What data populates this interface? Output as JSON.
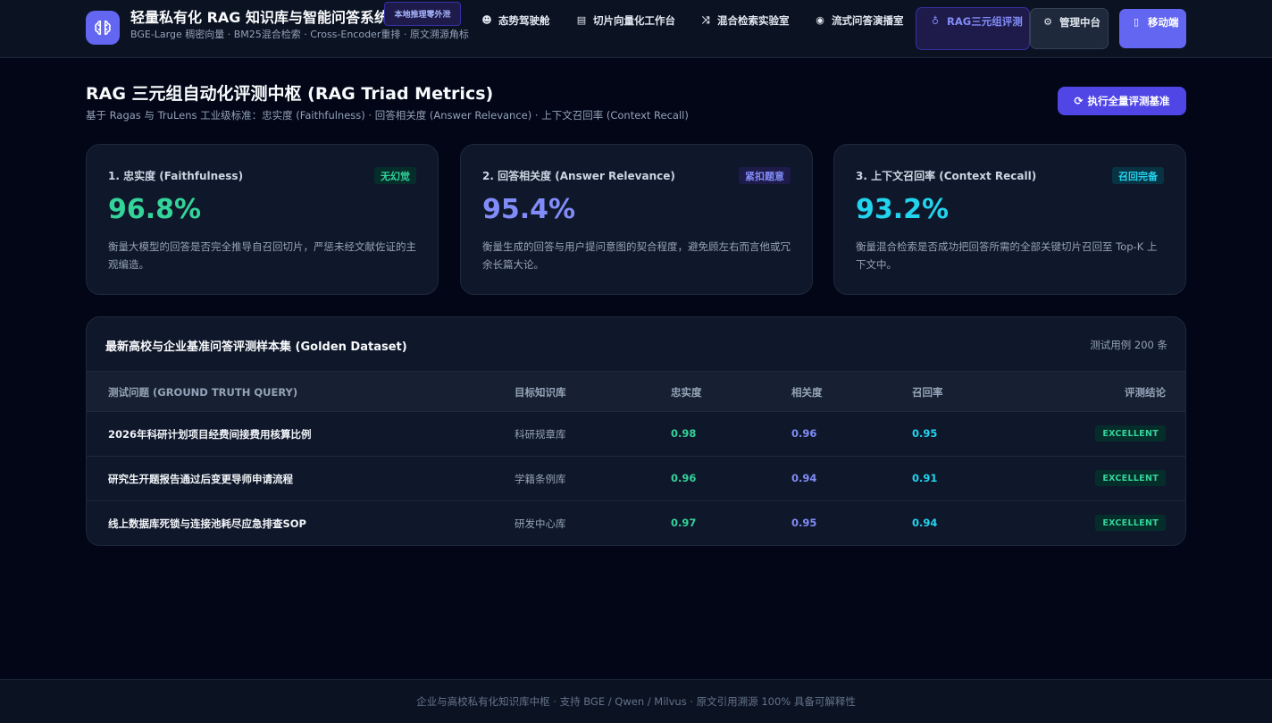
{
  "colors": {
    "accent": "#6366f1",
    "faithfulness": "#34d399",
    "relevance": "#818cf8",
    "recall": "#22d3ee",
    "excellent": "#34d399"
  },
  "header": {
    "logo_icon": "brain-icon",
    "title": "轻量私有化 RAG 知识库与智能问答系统",
    "badge": "本地推理零外泄",
    "subtitle": "BGE-Large 稠密向量 · BM25混合检索 · Cross-Encoder重排 · 原文溯源角标"
  },
  "nav": [
    {
      "icon": "dashboard-icon",
      "glyph": "☻",
      "label": "态势驾驶舱"
    },
    {
      "icon": "document-icon",
      "glyph": "▤",
      "label": "切片向量化工作台"
    },
    {
      "icon": "shuffle-icon",
      "glyph": "⤨",
      "label": "混合检索实验室"
    },
    {
      "icon": "chat-icon",
      "glyph": "◉",
      "label": "流式问答演播室"
    },
    {
      "icon": "medal-icon",
      "glyph": "♁",
      "label": "RAG三元组评测"
    },
    {
      "icon": "gear-icon",
      "glyph": "⚙",
      "label": "管理中台"
    },
    {
      "icon": "mobile-icon",
      "glyph": "▯",
      "label": "移动端"
    }
  ],
  "page": {
    "title": "RAG 三元组自动化评测中枢 (RAG Triad Metrics)",
    "subtitle": "基于 Ragas 与 TruLens 工业级标准：忠实度 (Faithfulness) · 回答相关度 (Answer Relevance) · 上下文召回率 (Context Recall)",
    "run_button": "执行全量评测基准"
  },
  "metrics": [
    {
      "title": "1. 忠实度 (Faithfulness)",
      "tag": "无幻觉",
      "value": "96.8%",
      "desc": "衡量大模型的回答是否完全推导自召回切片，严惩未经文献佐证的主观编造。"
    },
    {
      "title": "2. 回答相关度 (Answer Relevance)",
      "tag": "紧扣题意",
      "value": "95.4%",
      "desc": "衡量生成的回答与用户提问意图的契合程度，避免顾左右而言他或冗余长篇大论。"
    },
    {
      "title": "3. 上下文召回率 (Context Recall)",
      "tag": "召回完备",
      "value": "93.2%",
      "desc": "衡量混合检索是否成功把回答所需的全部关键切片召回至 Top-K 上下文中。"
    }
  ],
  "dataset": {
    "title": "最新高校与企业基准问答评测样本集 (Golden Dataset)",
    "count": "测试用例 200 条",
    "columns": [
      "测试问题 (GROUND TRUTH QUERY)",
      "目标知识库",
      "忠实度",
      "相关度",
      "召回率",
      "评测结论"
    ],
    "rows": [
      {
        "query": "2026年科研计划项目经费间接费用核算比例",
        "kb": "科研规章库",
        "faithfulness": "0.98",
        "relevance": "0.96",
        "recall": "0.95",
        "verdict": "EXCELLENT"
      },
      {
        "query": "研究生开题报告通过后变更导师申请流程",
        "kb": "学籍条例库",
        "faithfulness": "0.96",
        "relevance": "0.94",
        "recall": "0.91",
        "verdict": "EXCELLENT"
      },
      {
        "query": "线上数据库死锁与连接池耗尽应急排查SOP",
        "kb": "研发中心库",
        "faithfulness": "0.97",
        "relevance": "0.95",
        "recall": "0.94",
        "verdict": "EXCELLENT"
      }
    ]
  },
  "footer": "企业与高校私有化知识库中枢 · 支持 BGE / Qwen / Milvus · 原文引用溯源 100% 具备可解释性"
}
